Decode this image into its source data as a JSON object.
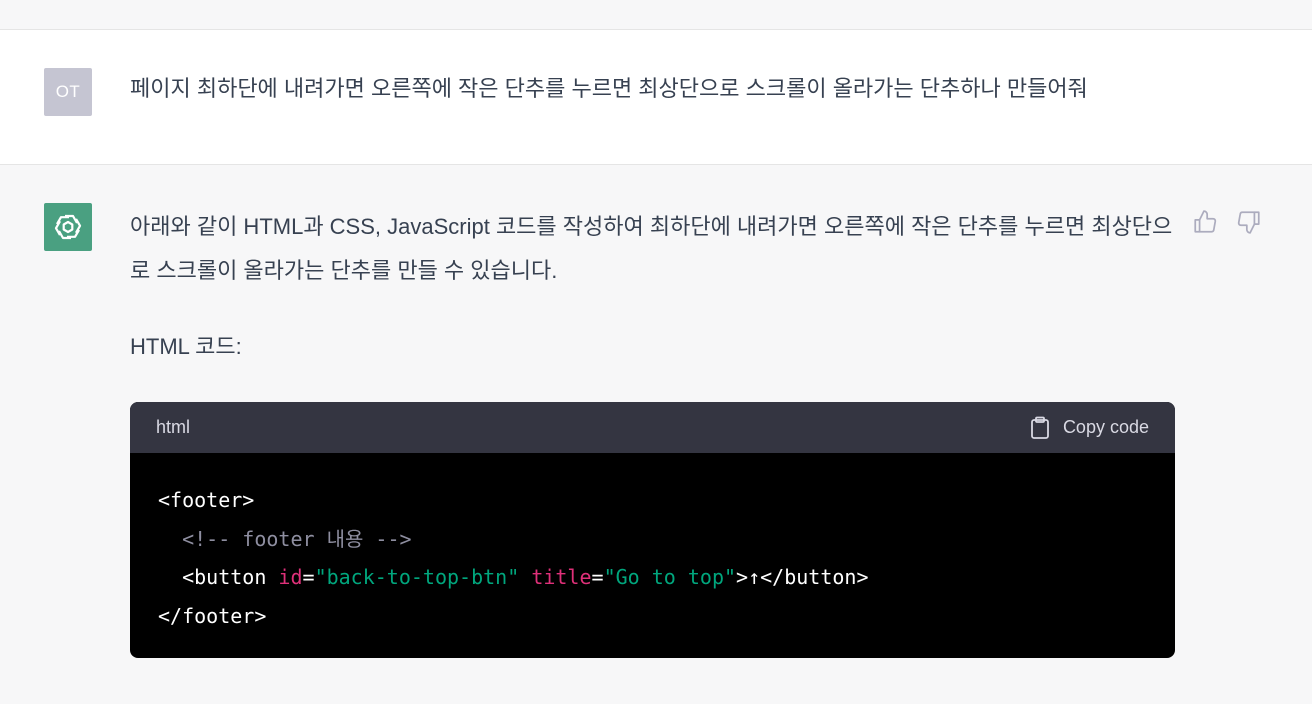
{
  "user_message": {
    "avatar_initials": "OT",
    "text": "페이지 최하단에 내려가면 오른쪽에 작은 단추를 누르면 최상단으로 스크롤이 올라가는 단추하나 만들어줘"
  },
  "assistant_message": {
    "avatar_icon": "openai-logo-icon",
    "intro_text": "아래와 같이 HTML과 CSS, JavaScript 코드를 작성하여 최하단에 내려가면 오른쪽에 작은 단추를 누르면 최상단으로 스크롤이 올라가는 단추를 만들 수 있습니다.",
    "section_heading": "HTML 코드:",
    "feedback": {
      "like_icon": "thumbs-up-icon",
      "dislike_icon": "thumbs-down-icon"
    },
    "code_block": {
      "language": "html",
      "copy_label": "Copy code",
      "lines": [
        {
          "indent": "",
          "parts": [
            {
              "t": "tag",
              "v": "<footer>"
            }
          ]
        },
        {
          "indent": "  ",
          "parts": [
            {
              "t": "comment",
              "v": "<!-- footer 내용 -->"
            }
          ]
        },
        {
          "indent": "  ",
          "parts": [
            {
              "t": "tag",
              "v": "<button "
            },
            {
              "t": "attr",
              "v": "id"
            },
            {
              "t": "tag",
              "v": "="
            },
            {
              "t": "str",
              "v": "\"back-to-top-btn\""
            },
            {
              "t": "tag",
              "v": " "
            },
            {
              "t": "attr",
              "v": "title"
            },
            {
              "t": "tag",
              "v": "="
            },
            {
              "t": "str",
              "v": "\"Go to top\""
            },
            {
              "t": "tag",
              "v": ">↑</button>"
            }
          ]
        },
        {
          "indent": "",
          "parts": [
            {
              "t": "tag",
              "v": "</footer>"
            }
          ]
        }
      ]
    }
  },
  "colors": {
    "page_bg": "#f7f7f8",
    "user_row_bg": "#ffffff",
    "user_avatar_bg": "#c5c5d2",
    "assistant_avatar_bg": "#4aa081",
    "code_header_bg": "#343541",
    "code_bg": "#000000",
    "code_attr": "#df3079",
    "code_string": "#00a67d",
    "code_comment": "#8e8ea0"
  }
}
